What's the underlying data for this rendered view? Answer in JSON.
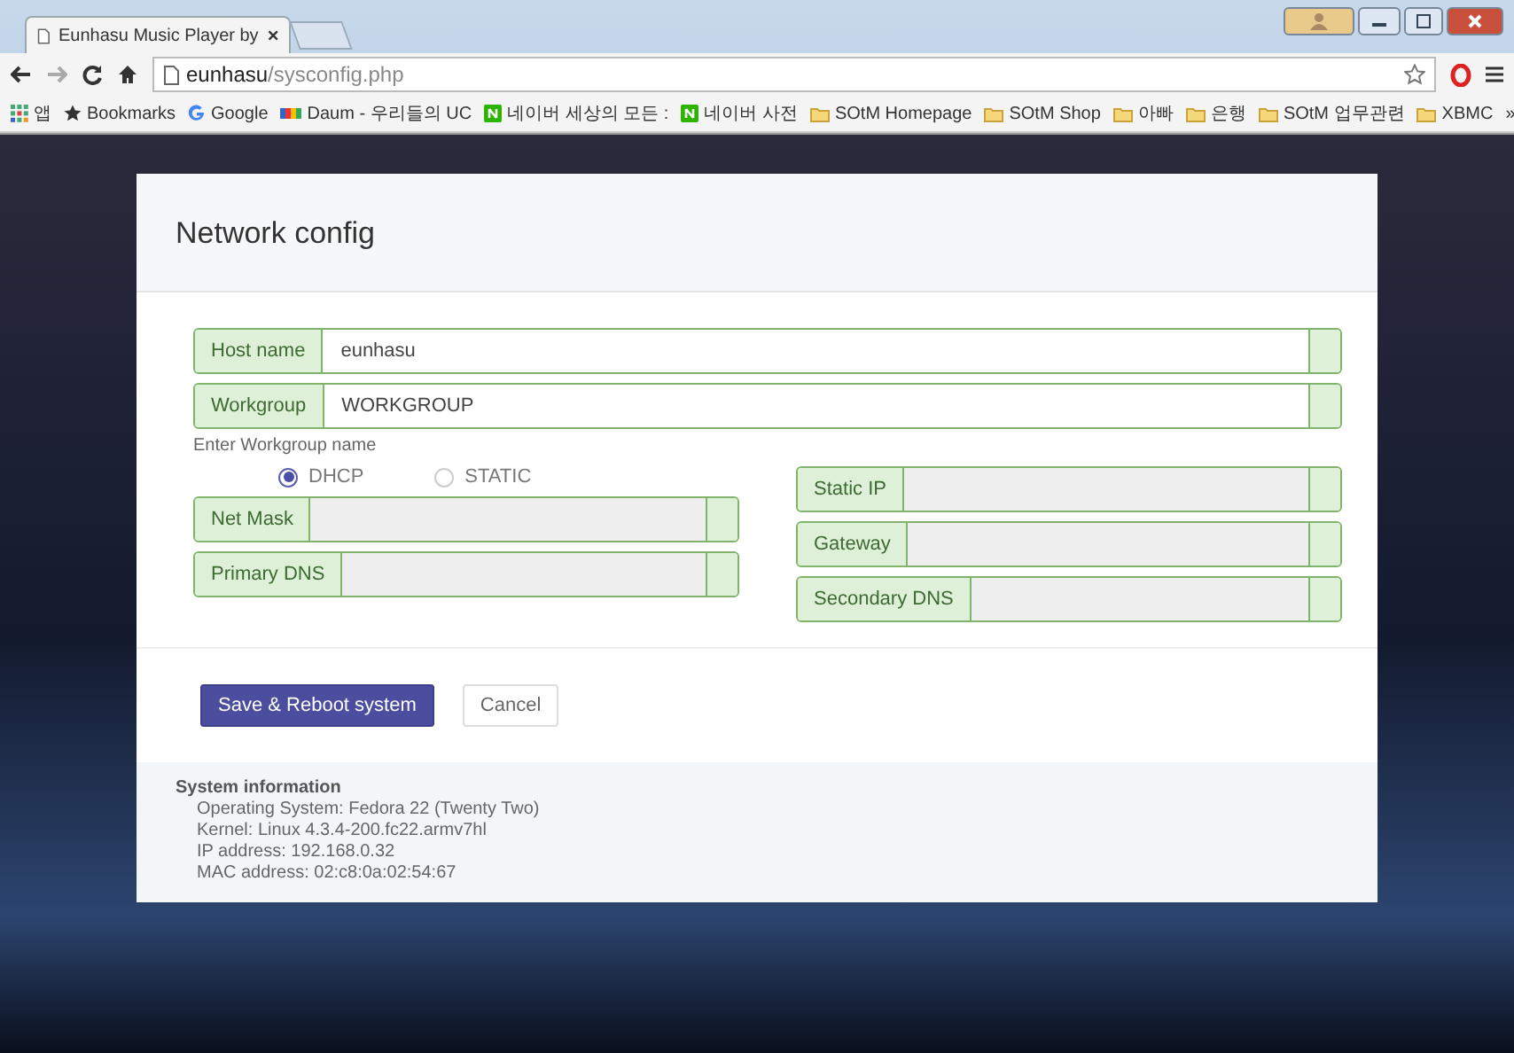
{
  "browser": {
    "tab_title": "Eunhasu Music Player by",
    "address": {
      "host": "eunhasu",
      "path": "/sysconfig.php"
    },
    "bookmarks": [
      {
        "kind": "apps",
        "label": "앱"
      },
      {
        "kind": "star",
        "label": "Bookmarks"
      },
      {
        "kind": "google",
        "label": "Google"
      },
      {
        "kind": "daum",
        "label": "Daum - 우리들의 UC"
      },
      {
        "kind": "naver",
        "label": "네이버 세상의 모든 :"
      },
      {
        "kind": "naver",
        "label": "네이버 사전"
      },
      {
        "kind": "folder",
        "label": "SOtM Homepage"
      },
      {
        "kind": "folder",
        "label": "SOtM Shop"
      },
      {
        "kind": "folder",
        "label": "아빠"
      },
      {
        "kind": "folder",
        "label": "은행"
      },
      {
        "kind": "folder",
        "label": "SOtM 업무관련"
      },
      {
        "kind": "folder",
        "label": "XBMC"
      }
    ],
    "overflow": "»"
  },
  "card": {
    "title": "Network config",
    "top_fields": [
      {
        "label": "Host name",
        "value": "eunhasu",
        "disabled": false
      },
      {
        "label": "Workgroup",
        "value": "WORKGROUP",
        "disabled": false
      }
    ],
    "help_text": "Enter Workgroup name",
    "ip_mode": [
      {
        "label": "DHCP",
        "selected": true
      },
      {
        "label": "STATIC",
        "selected": false
      }
    ],
    "left_fields": [
      {
        "label": "Net Mask",
        "disabled": true
      },
      {
        "label": "Primary DNS",
        "disabled": true
      }
    ],
    "right_fields": [
      {
        "label": "Static IP",
        "disabled": true
      },
      {
        "label": "Gateway",
        "disabled": true
      },
      {
        "label": "Secondary DNS",
        "disabled": true
      }
    ],
    "buttons": [
      {
        "kind": "primary",
        "label": "Save & Reboot system"
      },
      {
        "kind": "default",
        "label": "Cancel"
      }
    ],
    "system_info": {
      "title": "System information",
      "lines": [
        "Operating System: Fedora 22 (Twenty Two)",
        "Kernel: Linux 4.3.4-200.fc22.armv7hl",
        "IP address: 192.168.0.32",
        "MAC address: 02:c8:0a:02:54:67"
      ]
    }
  }
}
